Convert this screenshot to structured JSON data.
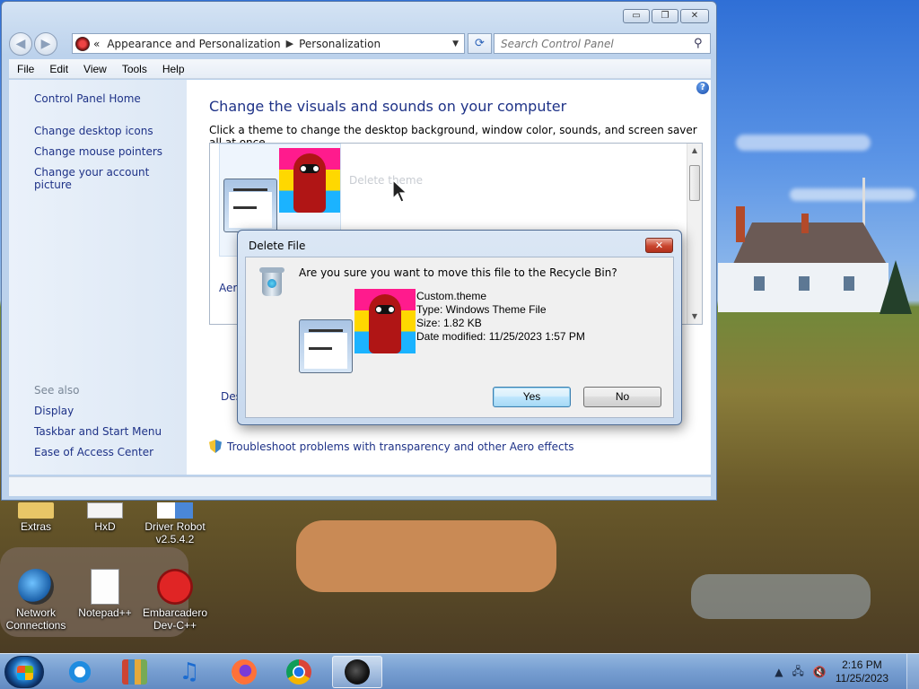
{
  "window": {
    "controls": {
      "minimize": "▭",
      "maximize": "❐",
      "close": "✕"
    },
    "breadcrumb": [
      "Appearance and Personalization",
      "Personalization"
    ],
    "breadcrumb_prefix": "«",
    "search_placeholder": "Search Control Panel",
    "menu": [
      "File",
      "Edit",
      "View",
      "Tools",
      "Help"
    ],
    "side_links": [
      "Control Panel Home",
      "Change desktop icons",
      "Change mouse pointers",
      "Change your account picture"
    ],
    "see_also_label": "See also",
    "see_also_links": [
      "Display",
      "Taskbar and Start Menu",
      "Ease of Access Center"
    ],
    "heading": "Change the visuals and sounds on your computer",
    "subtext": "Click a theme to change the desktop background, window color, sounds, and screen saver all at once.",
    "ghost_text": "Delete theme",
    "aero_fragment": "Aero",
    "desk_fragment": "Des",
    "troubleshoot_link": "Troubleshoot problems with transparency and other Aero effects"
  },
  "dialog": {
    "title": "Delete File",
    "close": "✕",
    "question": "Are you sure you want to move this file to the Recycle Bin?",
    "file_name": "Custom.theme",
    "file_type": "Type: Windows Theme File",
    "file_size": "Size: 1.82 KB",
    "file_date": "Date modified: 11/25/2023 1:57 PM",
    "yes_label": "Yes",
    "no_label": "No"
  },
  "desktop_icons": [
    {
      "label": "Extras",
      "icon": "folder-icon"
    },
    {
      "label": "HxD",
      "icon": "hxd-icon"
    },
    {
      "label": "Driver Robot v2.5.4.2",
      "icon": "driver-robot-icon"
    },
    {
      "label": "Network Connections",
      "icon": "network-icon"
    },
    {
      "label": "Notepad++",
      "icon": "notepad-plus-plus-icon"
    },
    {
      "label": "Embarcadero Dev-C++",
      "icon": "dev-cpp-icon"
    }
  ],
  "taskbar": {
    "apps": [
      "internet-explorer-icon",
      "archive-icon",
      "music-icon",
      "firefox-icon",
      "chrome-icon",
      "personalization-icon"
    ],
    "tray_symbols": [
      "▲",
      "🖧",
      "🔇"
    ],
    "time": "2:16 PM",
    "date": "11/25/2023"
  },
  "colors": {
    "link": "#1e3287",
    "dialog_close": "#c9462e",
    "taskbar": "#78a0d2"
  }
}
